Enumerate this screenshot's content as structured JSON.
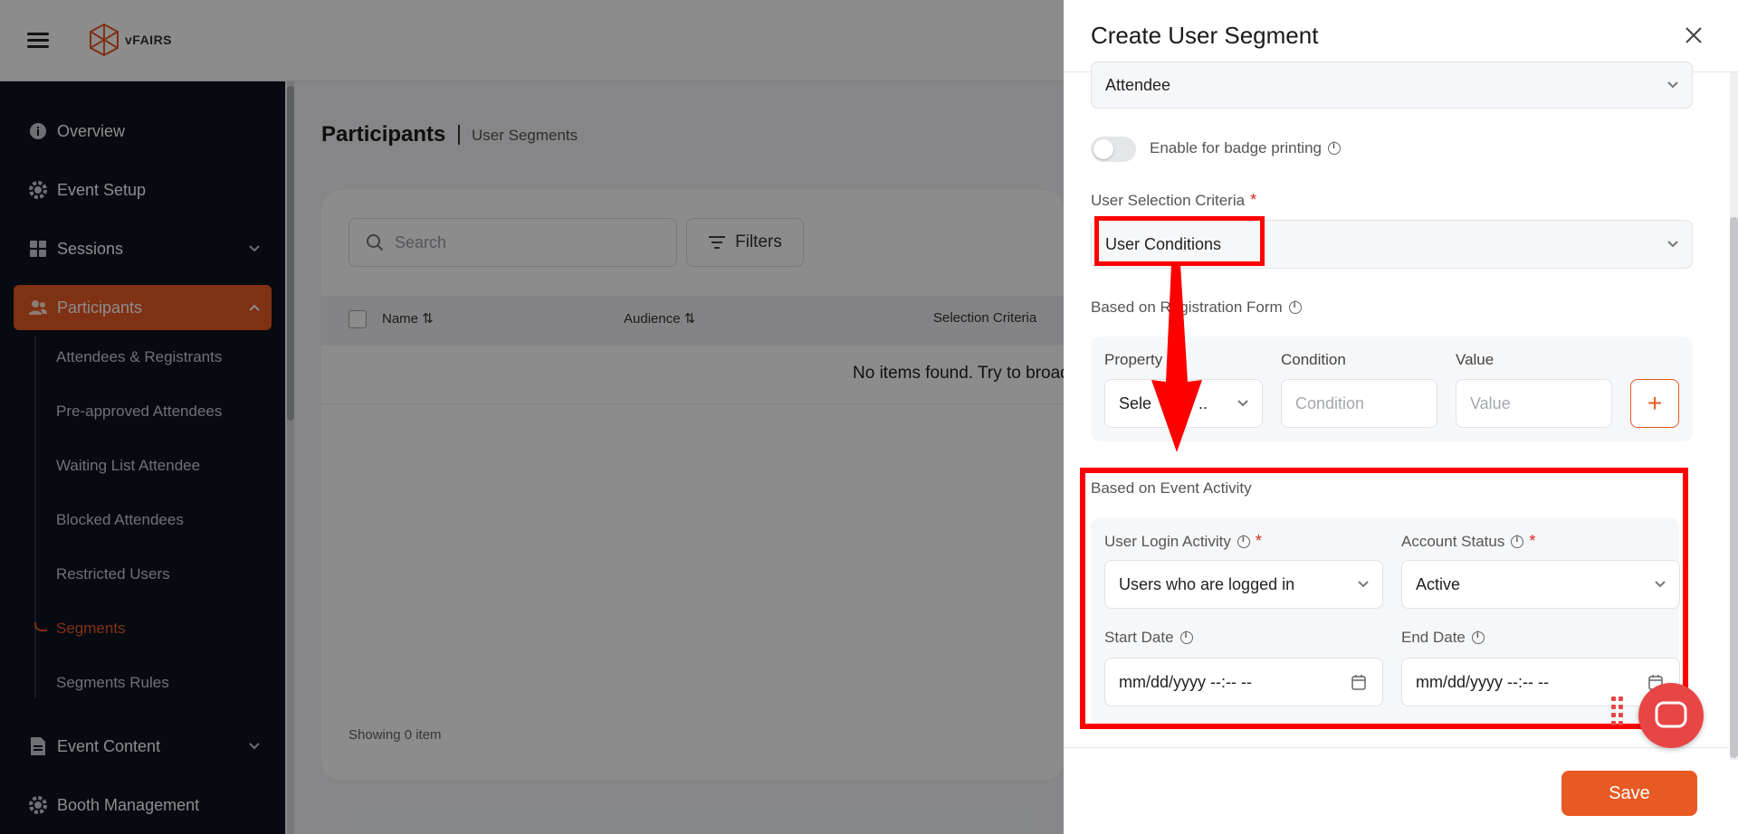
{
  "app": {
    "brand": "vFAIRS"
  },
  "sidebar": {
    "items": [
      {
        "label": "Overview",
        "icon": "info-circle-icon"
      },
      {
        "label": "Event Setup",
        "icon": "gear-icon"
      },
      {
        "label": "Sessions",
        "icon": "grid-icon"
      },
      {
        "label": "Participants",
        "icon": "users-icon"
      },
      {
        "label": "Event Content",
        "icon": "document-icon"
      },
      {
        "label": "Booth Management",
        "icon": "gear-icon"
      }
    ],
    "sub_items": [
      "Attendees & Registrants",
      "Pre-approved Attendees",
      "Waiting List Attendee",
      "Blocked Attendees",
      "Restricted Users",
      "Segments",
      "Segments Rules"
    ]
  },
  "main": {
    "title": "Participants",
    "breadcrumb": "User Segments",
    "search_placeholder": "Search",
    "filters_label": "Filters",
    "columns": [
      "Name",
      "Audience",
      "Selection Criteria"
    ],
    "empty_text": "No items found. Try to broade",
    "showing": "Showing 0 item"
  },
  "drawer": {
    "title": "Create User Segment",
    "audience_value": "Attendee",
    "badge_toggle_label": "Enable for badge printing",
    "criteria_label": "User Selection Criteria",
    "criteria_value": "User Conditions",
    "registration_section": "Based on Registration Form",
    "property_label": "Property",
    "property_value": "Sele",
    "property_value_tail": "..",
    "condition_label": "Condition",
    "condition_placeholder": "Condition",
    "value_label": "Value",
    "value_placeholder": "Value",
    "plus_symbol": "+",
    "activity_section": "Based on Event Activity",
    "login_activity_label": "User Login Activity",
    "login_activity_value": "Users who are logged in",
    "account_status_label": "Account Status",
    "account_status_value": "Active",
    "start_date_label": "Start Date",
    "start_date_value": "mm/dd/yyyy --:-- --",
    "end_date_label": "End Date",
    "end_date_value": "mm/dd/yyyy --:-- --",
    "required_mark": "*",
    "save_label": "Save"
  },
  "colors": {
    "accent": "#e85a24",
    "sidebar_bg": "#0e1320",
    "annotation": "#ff0000"
  }
}
